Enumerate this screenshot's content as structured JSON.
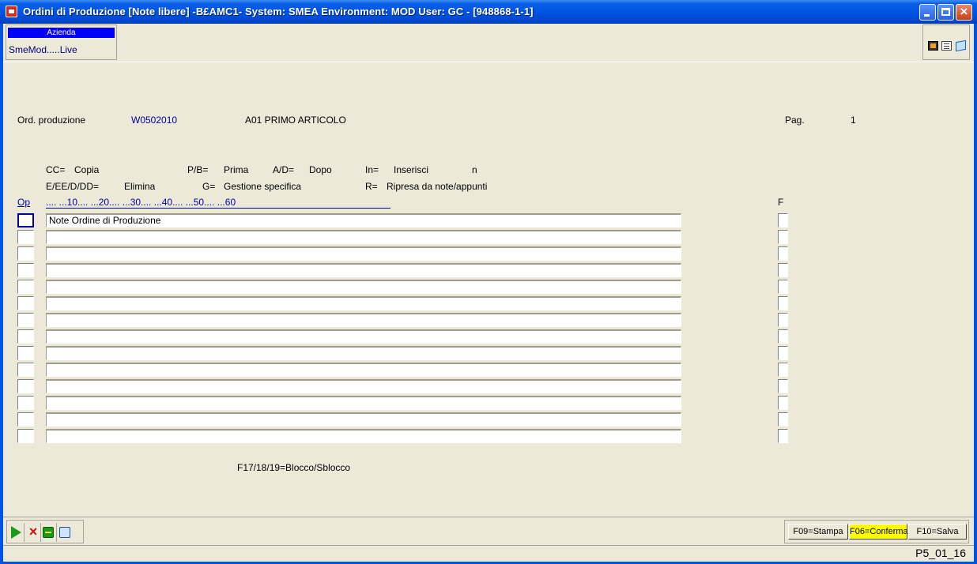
{
  "window": {
    "title": "Ordini di Produzione [Note libere] -B£AMC1- System: SMEA Environment: MOD User: GC - [948868-1-1]"
  },
  "company": {
    "header": "Azienda",
    "value": "SmeMod.....Live"
  },
  "header": {
    "order_label": "Ord. produzione",
    "order_value": "W0502010",
    "article": "A01 PRIMO ARTICOLO",
    "page_label": "Pag.",
    "page_value": "1"
  },
  "legend": {
    "row1": [
      {
        "code": "CC=",
        "text": "Copia"
      },
      {
        "code": "P/B=",
        "text": "Prima"
      },
      {
        "code": "A/D=",
        "text": "Dopo"
      },
      {
        "code": "In=",
        "text": "Inserisci"
      },
      {
        "code": "",
        "text": "n"
      }
    ],
    "row2": [
      {
        "code": "E/EE/D/DD=",
        "text": "Elimina"
      },
      {
        "code": "G=",
        "text": "Gestione specifica"
      },
      {
        "code": "R=",
        "text": "Ripresa da note/appunti"
      }
    ]
  },
  "grid": {
    "op_header": "Op",
    "ruler": ".... ...10.... ...20.... ...30.... ...40.... ...50.... ...60",
    "f_header": "F",
    "rows": [
      "Note Ordine di Produzione",
      "",
      "",
      "",
      "",
      "",
      "",
      "",
      "",
      "",
      "",
      "",
      "",
      ""
    ]
  },
  "footer_hint": "F17/18/19=Blocco/Sblocco",
  "actions": {
    "run": "run-icon",
    "cancel": "cancel-icon",
    "back": "back-icon",
    "window": "window-icon"
  },
  "function_keys": [
    {
      "label": "F09=Stampa",
      "highlight": false
    },
    {
      "label": "F06=Conferma",
      "highlight": true
    },
    {
      "label": "F10=Salva",
      "highlight": false
    }
  ],
  "status": {
    "program": "P5_01_16"
  },
  "colors": {
    "title_bar": "#0054e3",
    "background": "#ece9d8",
    "link_blue": "#0000a0",
    "highlight_key": "#ffff00"
  }
}
